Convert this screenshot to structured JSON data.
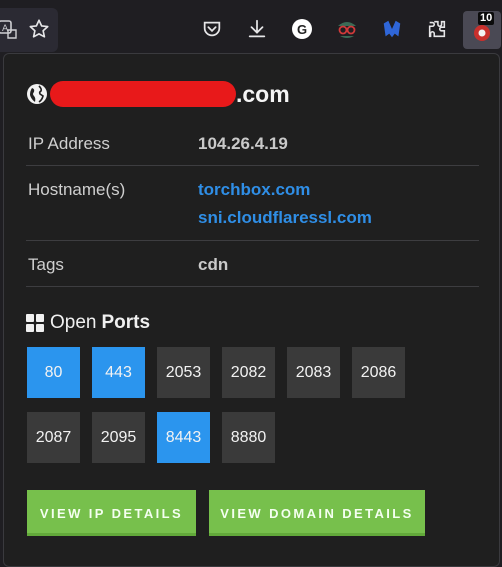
{
  "toolbar": {
    "icons": [
      "translate-icon",
      "bookmark-star-icon",
      "pocket-icon",
      "download-icon",
      "grammarly-icon",
      "spy-extension-icon",
      "malwarebytes-icon",
      "extensions-puzzle-icon",
      "shodan-extension-icon"
    ],
    "grammarly_letter": "G",
    "badge": "10"
  },
  "popup": {
    "host_suffix": ".com",
    "rows": {
      "ip_label": "IP Address",
      "ip_value": "104.26.4.19",
      "hostnames_label": "Hostname(s)",
      "hostnames": [
        "torchbox.com",
        "sni.cloudflaressl.com"
      ],
      "tags_label": "Tags",
      "tags_value": "cdn"
    },
    "ports_title_prefix": "Open",
    "ports_title_bold": "Ports",
    "ports": [
      "80",
      "443",
      "2053",
      "2082",
      "2083",
      "2086",
      "2087",
      "2095",
      "8443",
      "8880"
    ],
    "highlighted_ports": [
      "80",
      "443",
      "8443"
    ],
    "buttons": {
      "ip_details": "VIEW IP DETAILS",
      "domain_details": "VIEW DOMAIN DETAILS"
    },
    "colors": {
      "link": "#2f8ee6",
      "port_highlight": "#2b95ee",
      "port_default": "#3a3a3a",
      "button": "#77c04c",
      "redaction": "#e8191a"
    }
  }
}
